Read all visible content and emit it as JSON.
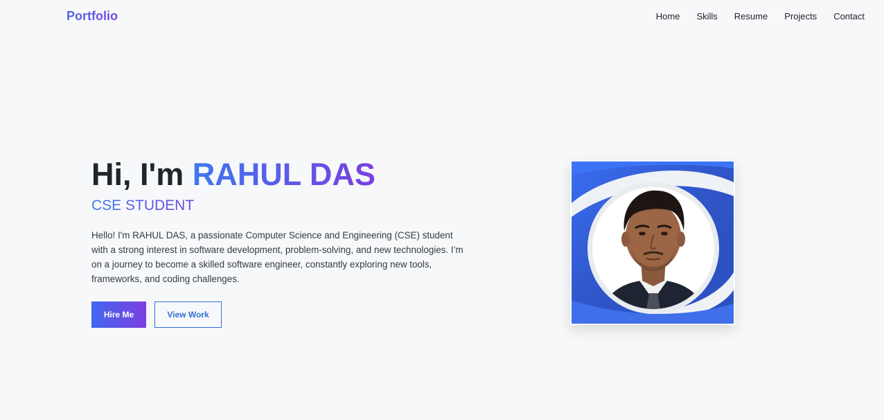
{
  "brand": "Portfolio",
  "nav": {
    "items": [
      "Home",
      "Skills",
      "Resume",
      "Projects",
      "Contact"
    ]
  },
  "hero": {
    "greeting": "Hi, I'm ",
    "name": "RAHUL DAS",
    "subtitle": "CSE STUDENT",
    "bio": "Hello! I'm RAHUL DAS, a passionate Computer Science and Engineering (CSE) student with a strong interest in software development, problem-solving, and new technologies. I’m on a journey to become a skilled software engineer, constantly exploring new tools, frameworks, and coding challenges.",
    "primary_button": "Hire Me",
    "secondary_button": "View Work"
  },
  "colors": {
    "accent_start": "#3e78f0",
    "accent_end": "#7b3fe0",
    "outline": "#2f6fd6",
    "background": "#f7f8fa"
  }
}
